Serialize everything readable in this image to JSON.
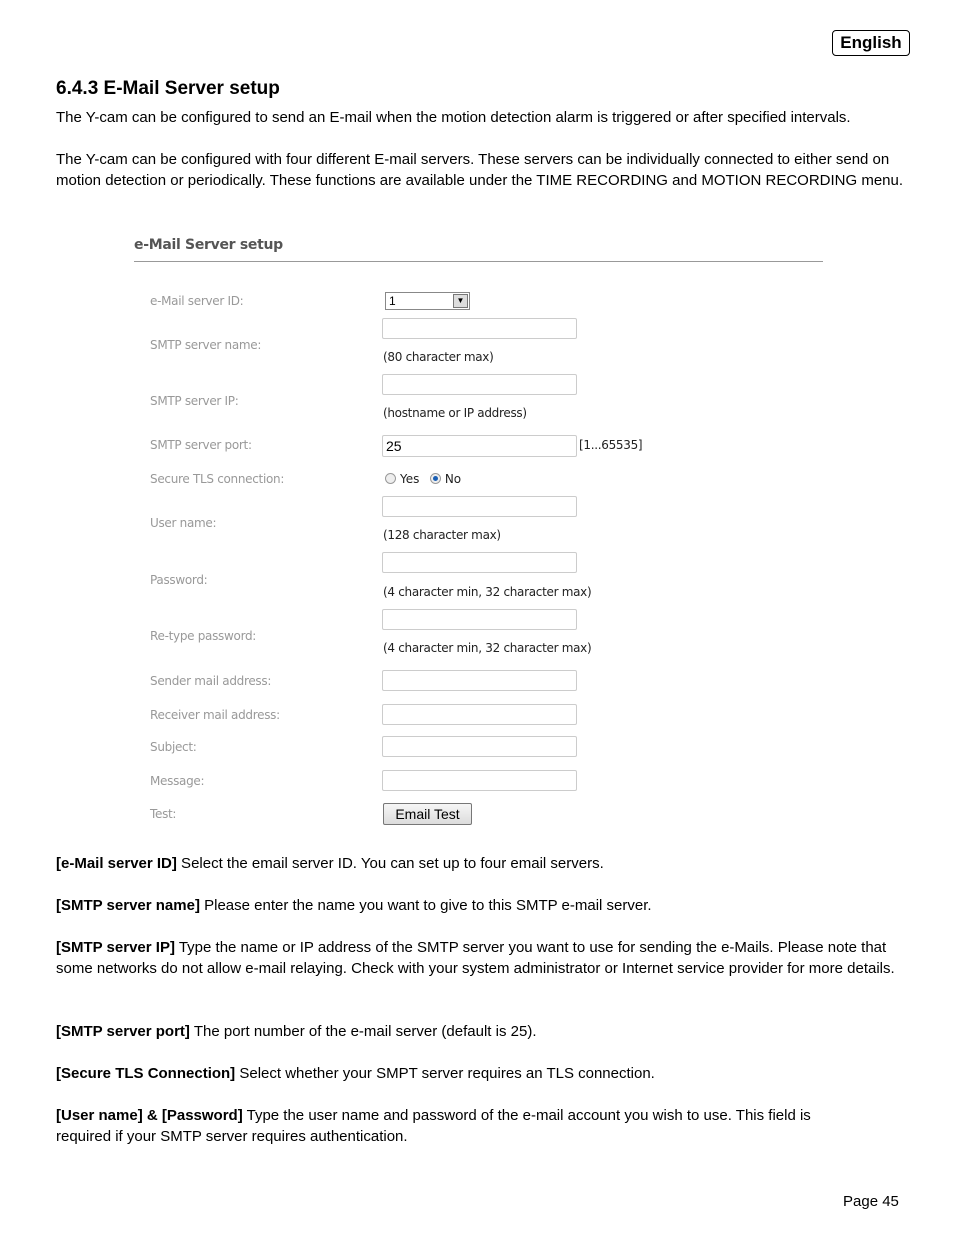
{
  "header": {
    "language": "English"
  },
  "section": {
    "title": "6.4.3  E-Mail Server setup"
  },
  "intro": [
    "The Y-cam can be configured to send an E-mail when the motion detection alarm is triggered or after specified intervals.",
    "The Y-cam can be configured with four different E-mail servers. These servers can be individually connected to either send on motion detection or periodically. These functions are available under the TIME RECORDING and MOTION RECORDING menu."
  ],
  "form": {
    "title": "e-Mail Server setup",
    "server_id": {
      "label": "e-Mail server ID:",
      "value": "1"
    },
    "smtp_name": {
      "label": "SMTP server name:",
      "value": "",
      "hint": "(80 character max)"
    },
    "smtp_ip": {
      "label": "SMTP server IP:",
      "value": "",
      "hint": "(hostname or IP address)"
    },
    "smtp_port": {
      "label": "SMTP server port:",
      "value": "25",
      "range": "[1...65535]"
    },
    "tls": {
      "label": "Secure TLS connection:",
      "options": [
        "Yes",
        "No"
      ],
      "selected": "No"
    },
    "user": {
      "label": "User name:",
      "value": "",
      "hint": "(128 character max)"
    },
    "password": {
      "label": "Password:",
      "value": "",
      "hint": "(4 character min, 32 character max)"
    },
    "retype": {
      "label": "Re-type password:",
      "value": "",
      "hint": "(4 character min, 32 character max)"
    },
    "sender": {
      "label": "Sender mail address:",
      "value": ""
    },
    "receiver": {
      "label": "Receiver mail address:",
      "value": ""
    },
    "subject": {
      "label": "Subject:",
      "value": ""
    },
    "message": {
      "label": "Message:",
      "value": ""
    },
    "test": {
      "label": "Test:",
      "button": "Email Test"
    }
  },
  "descriptions": [
    {
      "term": "[e-Mail server ID]",
      "text": " Select the email server ID. You can set up to four email servers."
    },
    {
      "term": "[SMTP server name]",
      "text": " Please enter the name you want to give to this SMTP e-mail server."
    },
    {
      "term": "[SMTP server IP]",
      "text": " Type the name or IP address of the SMTP server you want to use for sending the e-Mails. Please note that some networks do not allow e-mail relaying. Check with your system administrator or Internet service provider for more details."
    },
    {
      "term": "[SMTP server port]",
      "text": " The port number of the e-mail server (default is 25)."
    },
    {
      "term": "[Secure TLS Connection]",
      "text": " Select whether your SMPT server requires an TLS connection."
    },
    {
      "term": "[User name] & [Password]",
      "text": " Type the user name and password of the e-mail account you wish to use. This field is required if your SMTP server requires authentication."
    }
  ],
  "footer": {
    "page": "Page 45"
  }
}
